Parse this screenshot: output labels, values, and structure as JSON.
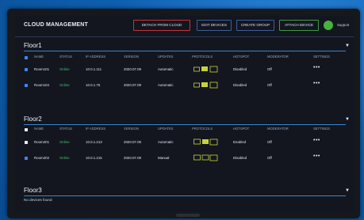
{
  "app": {
    "title": "CLOUD MANAGEMENT",
    "user_name": "Support"
  },
  "toolbar": {
    "detach_label": "DETACH FROM CLOUD",
    "edit_label": "EDIT DEVICES",
    "create_label": "CREATE GROUP",
    "attach_label": "ATTACH DEVICE"
  },
  "columns": [
    "NAME",
    "STATUS",
    "IP ADDRESS",
    "VERSION",
    "UPDATES",
    "PROTOCOLS",
    "HOTSPOT",
    "MODERATOR",
    "SETTINGS"
  ],
  "floors": [
    {
      "title": "Floor1",
      "rows": [
        {
          "name": "Room101",
          "status": "Online",
          "ip": "10.0.1.111",
          "version": "2020.07.09",
          "updates": "Automatic",
          "hotspot": "Disabled",
          "moderator": "Off",
          "settings": "•••"
        },
        {
          "name": "Room104",
          "status": "Online",
          "ip": "10.0.1.75",
          "version": "2020.07.09",
          "updates": "Automatic",
          "hotspot": "Disabled",
          "moderator": "Off",
          "settings": "•••"
        }
      ]
    },
    {
      "title": "Floor2",
      "rows": [
        {
          "name": "Room201",
          "status": "Online",
          "ip": "10.0.1.213",
          "version": "2020.07.09",
          "updates": "Automatic",
          "hotspot": "Enabled",
          "moderator": "Off",
          "settings": "•••"
        },
        {
          "name": "Room202",
          "status": "Online",
          "ip": "10.0.1.215",
          "version": "2020.07.09",
          "updates": "Manual",
          "hotspot": "Disabled",
          "moderator": "Off",
          "settings": "•••"
        }
      ]
    },
    {
      "title": "Floor3",
      "empty_text": "No devices found"
    }
  ],
  "colors": {
    "accent": "#3a86c8",
    "online": "#44c06a",
    "checkbox": "#3f86f0",
    "protocol": "#c8d23a"
  }
}
